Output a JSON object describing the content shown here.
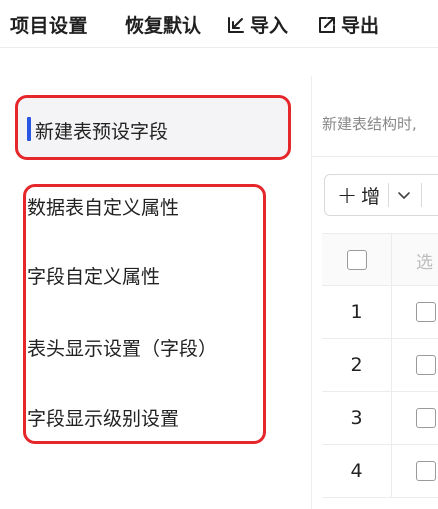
{
  "toolbar": {
    "title": "项目设置",
    "reset_label": "恢复默认",
    "import_label": "导入",
    "export_label": "导出"
  },
  "sidebar": {
    "active_item": "新建表预设字段",
    "items": [
      {
        "label": "数据表自定义属性"
      },
      {
        "label": "字段自定义属性"
      },
      {
        "label": "表头显示设置（字段）"
      },
      {
        "label": "字段显示级别设置"
      }
    ]
  },
  "main": {
    "hint_text": "新建表结构时,",
    "add_button_label": "增",
    "table": {
      "header_select_label": "选",
      "rows": [
        {
          "index": "1"
        },
        {
          "index": "2"
        },
        {
          "index": "3"
        },
        {
          "index": "4"
        }
      ]
    }
  },
  "colors": {
    "accent": "#2956e3",
    "highlight_box": "#e5262a",
    "active_bg": "#f4f4f6"
  }
}
